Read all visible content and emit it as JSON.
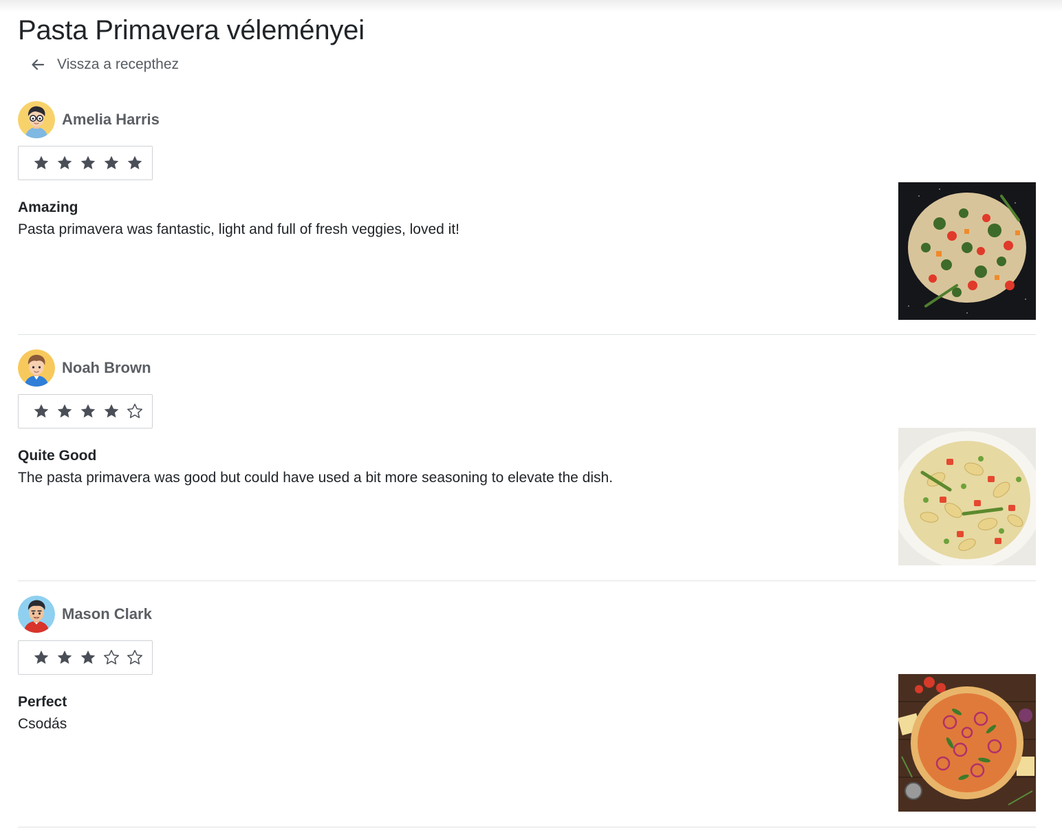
{
  "page": {
    "title": "Pasta Primavera véleményei",
    "back_label": "Vissza a recepthez"
  },
  "colors": {
    "star": "#4a4f57",
    "name": "#5b5f64",
    "divider": "#dfe1e4"
  },
  "reviews": [
    {
      "user": "Amelia Harris",
      "avatar": "avatar-glasses",
      "rating": 5,
      "max_rating": 5,
      "title": "Amazing",
      "text": "Pasta primavera was fantastic, light and full of fresh veggies, loved it!",
      "photo": "pasta-dark-plate-photo"
    },
    {
      "user": "Noah Brown",
      "avatar": "avatar-boy",
      "rating": 4,
      "max_rating": 5,
      "title": "Quite Good",
      "text": "The pasta primavera was good but could have used a bit more seasoning to elevate the dish.",
      "photo": "pasta-white-plate-photo"
    },
    {
      "user": "Mason Clark",
      "avatar": "avatar-red-hoodie",
      "rating": 3,
      "max_rating": 5,
      "title": "Perfect",
      "text": "Csodás",
      "photo": "pizza-photo"
    }
  ]
}
